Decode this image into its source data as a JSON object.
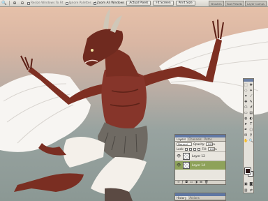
{
  "options_bar": {
    "checkboxes": [
      {
        "label": "Resize Windows To Fit",
        "checked": false
      },
      {
        "label": "Ignore Palettes",
        "checked": false
      },
      {
        "label": "Zoom All Windows",
        "checked": true
      }
    ],
    "buttons": [
      "Actual Pixels",
      "Fit Screen",
      "Print Size"
    ],
    "palette_well_tabs": [
      "Brushes",
      "Tool Presets",
      "Layer Comps"
    ]
  },
  "layers_panel": {
    "tabs": [
      "Layers",
      "Channels",
      "Paths"
    ],
    "blend_mode": "Normal",
    "opacity_label": "Opacity:",
    "opacity_value": "100%",
    "lock_label": "Lock:",
    "fill_label": "Fill:",
    "fill_value": "100%",
    "layers": [
      {
        "name": "Layer 12",
        "state": "normal"
      },
      {
        "name": "Layer 14",
        "state": "selected"
      }
    ]
  },
  "history_panel": {
    "tabs": [
      "History",
      "Actions"
    ]
  },
  "colors": {
    "foreground": "#2a1414",
    "background": "#ffffff"
  }
}
